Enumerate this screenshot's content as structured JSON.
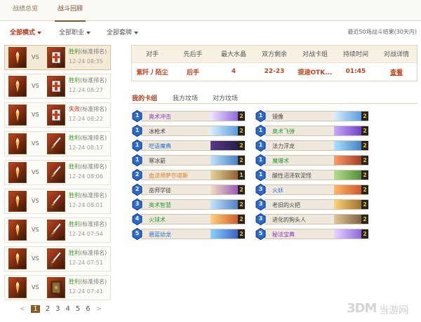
{
  "tabs": [
    {
      "label": "战绩总览"
    },
    {
      "label": "战斗回顾"
    }
  ],
  "filters": [
    {
      "label": "全部模式"
    },
    {
      "label": "全部职业"
    },
    {
      "label": "全部套牌"
    }
  ],
  "summary": "最近50场战斗结果(30天内)",
  "matches": [
    {
      "result": "胜利",
      "mode": "(标准排名)",
      "time": "12-24 08:35",
      "opp": "priest"
    },
    {
      "result": "胜利",
      "mode": "(标准排名)",
      "time": "12-24 08:27",
      "opp": "priest"
    },
    {
      "result": "失败",
      "mode": "(标准排名)",
      "time": "12-24 08:22",
      "opp": "priest"
    },
    {
      "result": "胜利",
      "mode": "(标准排名)",
      "time": "12-24 08:17",
      "opp": "sword"
    },
    {
      "result": "胜利",
      "mode": "(标准排名)",
      "time": "12-24 08:06",
      "opp": "sword"
    },
    {
      "result": "胜利",
      "mode": "(标准排名)",
      "time": "12-24 08:01",
      "opp": "sword"
    },
    {
      "result": "胜利",
      "mode": "(标准排名)",
      "time": "12-24 07:54",
      "opp": "sword"
    },
    {
      "result": "胜利",
      "mode": "(标准排名)",
      "time": "12-24 07:51",
      "opp": "sword"
    },
    {
      "result": "胜利",
      "mode": "(标准排名)",
      "time": "12-24 07:41",
      "opp": "book"
    }
  ],
  "pagination": {
    "prev": "<",
    "pages": [
      "1",
      "2",
      "3",
      "4",
      "5",
      "6"
    ],
    "next": ">"
  },
  "detail": {
    "headers": [
      "对手",
      "先后手",
      "最大水晶",
      "双方剩余",
      "对战卡组",
      "持续时间",
      "对战详情"
    ],
    "row": [
      "紫阡丿陌尘",
      "后手",
      "4",
      "22-23",
      "提速OTK...",
      "01:45",
      "查看"
    ]
  },
  "deck_tabs": [
    {
      "label": "我的卡组"
    },
    {
      "label": "我方坟场"
    },
    {
      "label": "对方坟场"
    }
  ],
  "deck_left": [
    {
      "cost": "1",
      "name": "奥术冲击",
      "rarity": "epic",
      "count": "2",
      "art": [
        "#f3e6ff",
        "#7a4ad8"
      ]
    },
    {
      "cost": "1",
      "name": "冰枪术",
      "rarity": "common",
      "count": "2",
      "art": [
        "#d6f0ff",
        "#3a8ad8"
      ]
    },
    {
      "cost": "1",
      "name": "呓语魔典",
      "rarity": "rare",
      "count": "2",
      "art": [
        "#5a3a8a",
        "#1a1a3a"
      ]
    },
    {
      "cost": "1",
      "name": "寒冰箭",
      "rarity": "common",
      "count": "2",
      "art": [
        "#bfe4ff",
        "#2a6ab8"
      ]
    },
    {
      "cost": "2",
      "name": "血法师萨尔诺斯",
      "rarity": "legend",
      "count": "1",
      "art": [
        "#e9d39a",
        "#7a4a1a"
      ]
    },
    {
      "cost": "2",
      "name": "巫师学徒",
      "rarity": "common",
      "count": "2",
      "art": [
        "#f1e0c0",
        "#8a3ab8"
      ]
    },
    {
      "cost": "3",
      "name": "奥术智慧",
      "rarity": "spec",
      "count": "2",
      "art": [
        "#bfe4ff",
        "#3a6ab8"
      ]
    },
    {
      "cost": "4",
      "name": "火球术",
      "rarity": "spec",
      "count": "2",
      "art": [
        "#ffd27a",
        "#c4411d"
      ]
    },
    {
      "cost": "5",
      "name": "碧蓝幼龙",
      "rarity": "rare",
      "count": "2",
      "art": [
        "#8ad2ff",
        "#2a4ab8"
      ]
    }
  ],
  "deck_right": [
    {
      "cost": "1",
      "name": "镜像",
      "rarity": "common",
      "count": "2",
      "art": [
        "#d6f0ff",
        "#3a8ad8"
      ]
    },
    {
      "cost": "1",
      "name": "奥术飞弹",
      "rarity": "spec",
      "count": "2",
      "art": [
        "#c7a8ff",
        "#5a2ab8"
      ]
    },
    {
      "cost": "1",
      "name": "法力浮龙",
      "rarity": "common",
      "count": "2",
      "art": [
        "#a8e4ff",
        "#2a6ab8"
      ]
    },
    {
      "cost": "1",
      "name": "魔爆术",
      "rarity": "spec",
      "count": "2",
      "art": [
        "#ff9a6a",
        "#8a2a1a"
      ]
    },
    {
      "cost": "1",
      "name": "酸性沼泽软泥怪",
      "rarity": "common",
      "count": "2",
      "art": [
        "#b8e08a",
        "#3a7a2a"
      ]
    },
    {
      "cost": "3",
      "name": "火妖",
      "rarity": "rare",
      "count": "2",
      "art": [
        "#ffb86a",
        "#c4411d"
      ]
    },
    {
      "cost": "3",
      "name": "老旧的火把",
      "rarity": "common",
      "count": "2",
      "art": [
        "#ffd27a",
        "#8a5a1a"
      ]
    },
    {
      "cost": "3",
      "name": "进化的狗头人",
      "rarity": "common",
      "count": "2",
      "art": [
        "#e0c89a",
        "#6a4a2a"
      ]
    },
    {
      "cost": "5",
      "name": "秘法宝典",
      "rarity": "epic",
      "count": "2",
      "art": [
        "#e6d6ff",
        "#7a4ad8"
      ]
    }
  ],
  "watermark": {
    "brand": "3DM",
    "text": "当游网"
  },
  "colors": {
    "accent": "#b33a1a",
    "win": "#3a9a2a",
    "lose": "#cc2a1a",
    "mana": "#2a6bd1"
  }
}
